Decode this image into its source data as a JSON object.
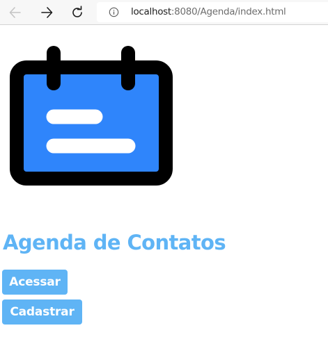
{
  "browser": {
    "url_host": "localhost",
    "url_rest": ":8080/Agenda/index.html",
    "back_icon": "arrow-left-icon",
    "forward_icon": "arrow-right-icon",
    "reload_icon": "reload-icon",
    "info_icon": "info-icon"
  },
  "page": {
    "logo_icon": "calendar-icon",
    "title": "Agenda de Contatos",
    "buttons": {
      "acessar_label": "Acessar",
      "cadastrar_label": "Cadastrar"
    }
  },
  "colors": {
    "accent": "#5fb4f5",
    "logo_fill": "#2f85fb",
    "logo_stroke": "#000000"
  }
}
